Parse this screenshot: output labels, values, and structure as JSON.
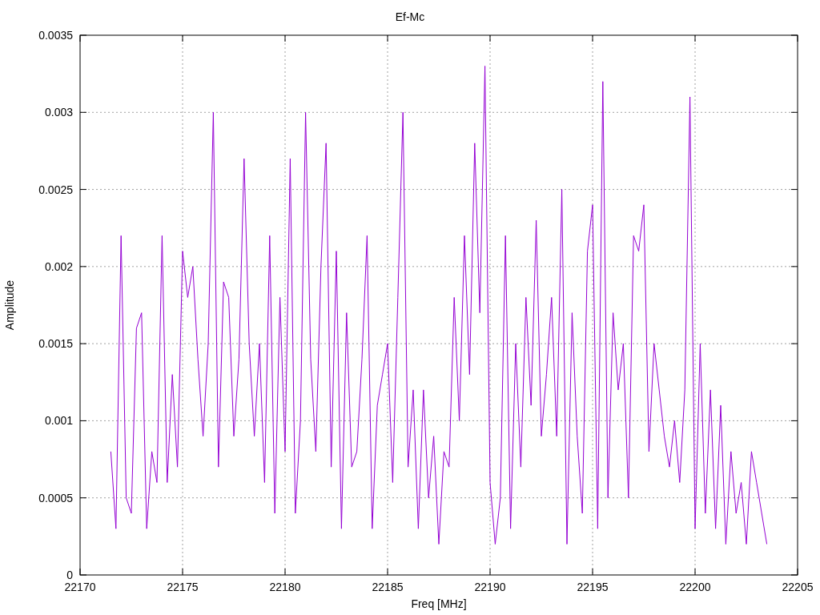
{
  "chart_data": {
    "type": "line",
    "title": "Ef-Mc",
    "xlabel": "Freq [MHz]",
    "ylabel": "Amplitude",
    "xlim": [
      22170,
      22205
    ],
    "ylim": [
      0,
      0.0035
    ],
    "xticks": [
      22170,
      22175,
      22180,
      22185,
      22190,
      22195,
      22200,
      22205
    ],
    "yticks": [
      {
        "value": 0,
        "label": "0"
      },
      {
        "value": 0.0005,
        "label": "0.0005"
      },
      {
        "value": 0.001,
        "label": "0.001"
      },
      {
        "value": 0.0015,
        "label": "0.0015"
      },
      {
        "value": 0.002,
        "label": "0.002"
      },
      {
        "value": 0.0025,
        "label": "0.0025"
      },
      {
        "value": 0.003,
        "label": "0.003"
      },
      {
        "value": 0.0035,
        "label": "0.0035"
      }
    ],
    "x": [
      22171.5,
      22171.75,
      22172,
      22172.25,
      22172.5,
      22172.75,
      22173,
      22173.25,
      22173.5,
      22173.75,
      22174,
      22174.25,
      22174.5,
      22174.75,
      22175,
      22175.25,
      22175.5,
      22175.75,
      22176,
      22176.25,
      22176.5,
      22176.75,
      22177,
      22177.25,
      22177.5,
      22177.75,
      22178,
      22178.25,
      22178.5,
      22178.75,
      22179,
      22179.25,
      22179.5,
      22179.75,
      22180,
      22180.25,
      22180.5,
      22180.75,
      22181,
      22181.25,
      22181.5,
      22181.75,
      22182,
      22182.25,
      22182.5,
      22182.75,
      22183,
      22183.25,
      22183.5,
      22183.75,
      22184,
      22184.25,
      22184.5,
      22184.75,
      22185,
      22185.25,
      22185.5,
      22185.75,
      22186,
      22186.25,
      22186.5,
      22186.75,
      22187,
      22187.25,
      22187.5,
      22187.75,
      22188,
      22188.25,
      22188.5,
      22188.75,
      22189,
      22189.25,
      22189.5,
      22189.75,
      22190,
      22190.25,
      22190.5,
      22190.75,
      22191,
      22191.25,
      22191.5,
      22191.75,
      22192,
      22192.25,
      22192.5,
      22192.75,
      22193,
      22193.25,
      22193.5,
      22193.75,
      22194,
      22194.25,
      22194.5,
      22194.75,
      22195,
      22195.25,
      22195.5,
      22195.75,
      22196,
      22196.25,
      22196.5,
      22196.75,
      22197,
      22197.25,
      22197.5,
      22197.75,
      22198,
      22198.25,
      22198.5,
      22198.75,
      22199,
      22199.25,
      22199.5,
      22199.75,
      22200,
      22200.25,
      22200.5,
      22200.75,
      22201,
      22201.25,
      22201.5,
      22201.75,
      22202,
      22202.25,
      22202.5,
      22202.75,
      22203,
      22203.25,
      22203.5
    ],
    "grid": true,
    "series": [
      {
        "color": "#9400d3",
        "values": [
          0.0008,
          0.0003,
          0.0022,
          0.0005,
          0.0004,
          0.0016,
          0.0017,
          0.0003,
          0.0008,
          0.0006,
          0.0022,
          0.0006,
          0.0013,
          0.0007,
          0.0021,
          0.0018,
          0.002,
          0.0014,
          0.0009,
          0.0015,
          0.003,
          0.0007,
          0.0019,
          0.0018,
          0.0009,
          0.0014,
          0.0027,
          0.0015,
          0.0009,
          0.0015,
          0.0006,
          0.0022,
          0.0004,
          0.0018,
          0.0008,
          0.0027,
          0.0004,
          0.001,
          0.003,
          0.0014,
          0.0008,
          0.002,
          0.0028,
          0.0007,
          0.0021,
          0.0003,
          0.0017,
          0.0007,
          0.0008,
          0.0014,
          0.0022,
          0.0003,
          0.0011,
          0.0013,
          0.0015,
          0.0006,
          0.0018,
          0.003,
          0.0007,
          0.0012,
          0.0003,
          0.0012,
          0.0005,
          0.0009,
          0.0002,
          0.0008,
          0.0007,
          0.0018,
          0.001,
          0.0022,
          0.0013,
          0.0028,
          0.0017,
          0.0033,
          0.0006,
          0.0002,
          0.0005,
          0.0022,
          0.0003,
          0.0015,
          0.0007,
          0.0018,
          0.0011,
          0.0023,
          0.0009,
          0.0013,
          0.0018,
          0.0009,
          0.0025,
          0.0002,
          0.0017,
          0.0009,
          0.0004,
          0.0021,
          0.0024,
          0.0003,
          0.0032,
          0.0005,
          0.0017,
          0.0012,
          0.0015,
          0.0005,
          0.0022,
          0.0021,
          0.0024,
          0.0008,
          0.0015,
          0.0012,
          0.0009,
          0.0007,
          0.001,
          0.0006,
          0.0012,
          0.0031,
          0.0003,
          0.0015,
          0.0004,
          0.0012,
          0.0003,
          0.0011,
          0.0002,
          0.0008,
          0.0004,
          0.0006,
          0.0002,
          0.0008,
          0.0006,
          0.0004,
          0.0002
        ]
      }
    ]
  }
}
